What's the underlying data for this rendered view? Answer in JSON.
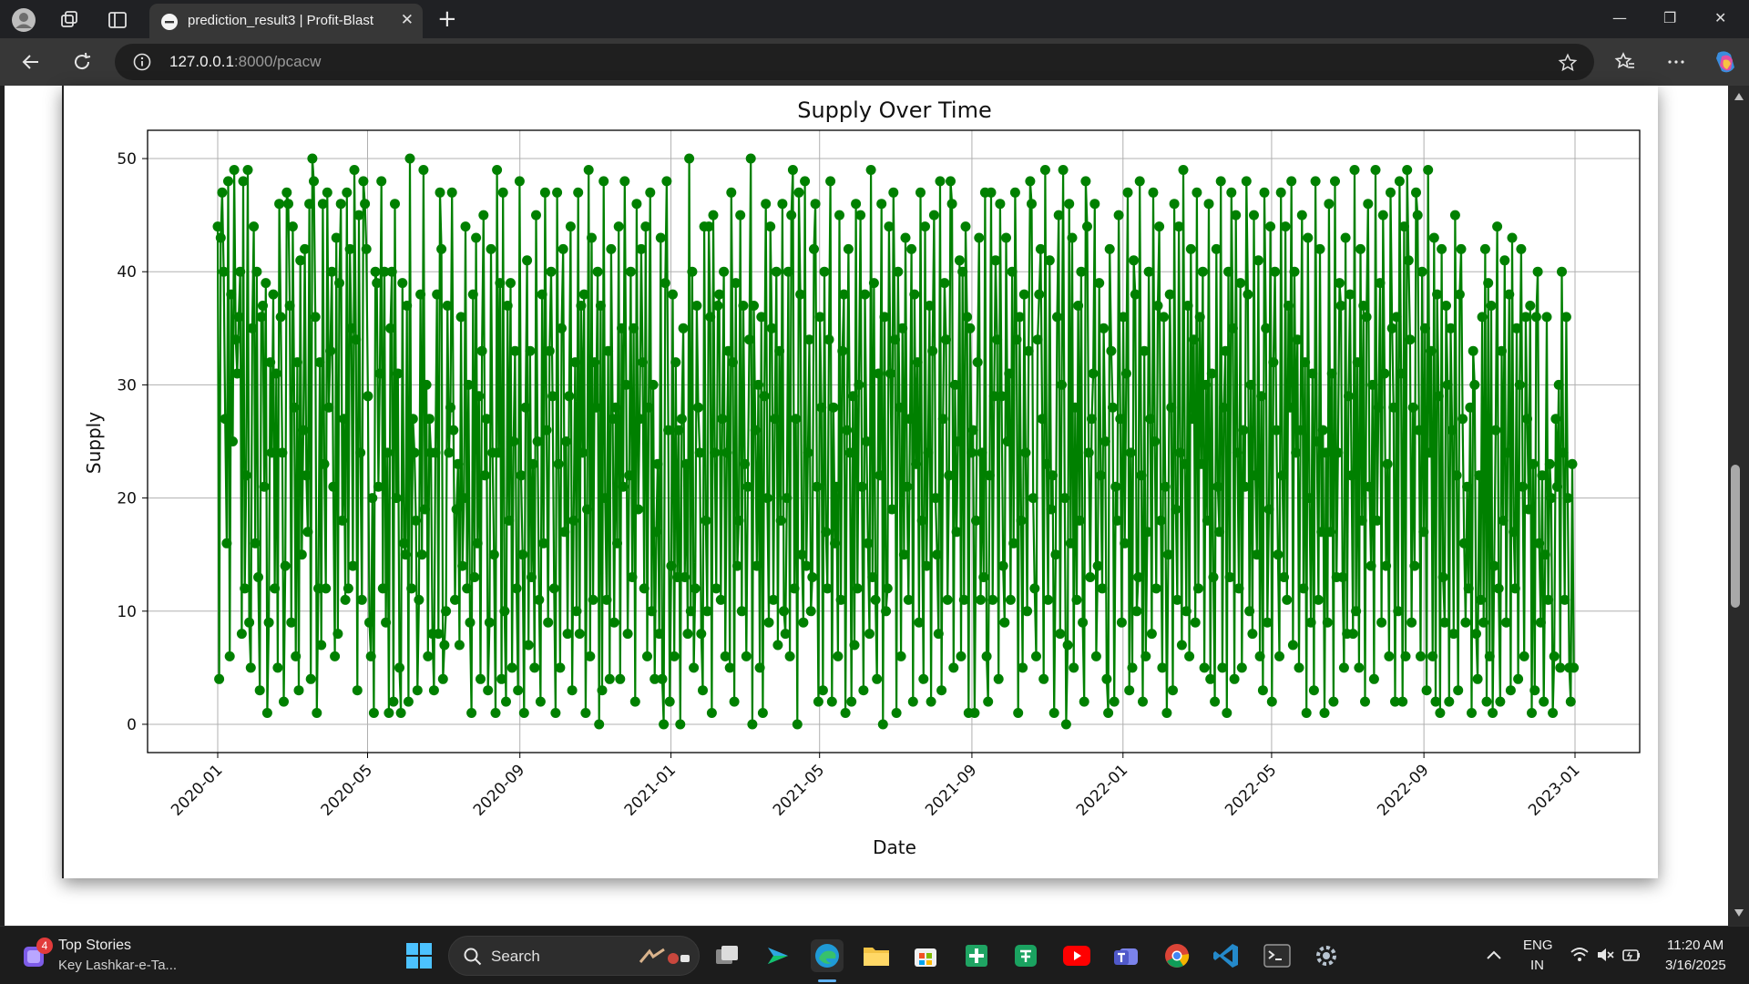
{
  "browser": {
    "tab_title": "prediction_result3 | Profit-Blast",
    "tab_close": "✕",
    "new_tab": "+",
    "url_host": "127.0.0.1",
    "url_rest": ":8000/pcacw",
    "window_controls": {
      "minimize": "—",
      "restore": "❐",
      "close": "✕"
    }
  },
  "chart_data": {
    "type": "line",
    "title": "Supply Over Time",
    "xlabel": "Date",
    "ylabel": "Supply",
    "ylim": [
      -2.5,
      52.5
    ],
    "yticks": [
      0,
      10,
      20,
      30,
      40,
      50
    ],
    "x_tick_labels": [
      "2020-01",
      "2020-05",
      "2020-09",
      "2021-01",
      "2021-05",
      "2021-09",
      "2022-01",
      "2022-05",
      "2022-09",
      "2023-01"
    ],
    "x_tick_dates": [
      "2020-01-01",
      "2020-05-01",
      "2020-09-01",
      "2021-01-01",
      "2021-05-01",
      "2021-09-01",
      "2022-01-01",
      "2022-05-01",
      "2022-09-01",
      "2023-01-01"
    ],
    "x_start": "2020-01-01",
    "x_end": "2022-12-31",
    "grid": true,
    "marker": "circle",
    "line_color": "#008000",
    "series": [
      {
        "values": [
          44,
          4,
          43,
          47,
          40,
          27,
          16,
          48,
          6,
          38,
          25,
          49,
          34,
          31,
          36,
          40,
          8,
          48,
          12,
          22,
          49,
          9,
          5,
          35,
          44,
          16,
          40,
          13,
          3,
          36,
          37,
          21,
          39,
          1,
          9,
          32,
          24,
          38,
          12,
          31,
          5,
          46,
          36,
          24,
          2,
          14,
          47,
          46,
          37,
          9,
          44,
          28,
          6,
          32,
          3,
          41,
          15,
          26,
          42,
          22,
          17,
          46,
          4,
          50,
          48,
          36,
          1,
          12,
          32,
          7,
          46,
          23,
          12,
          47,
          28,
          33,
          40,
          21,
          6,
          43,
          8,
          39,
          46,
          18,
          27,
          11,
          47,
          12,
          42,
          35,
          14,
          49,
          34,
          3,
          45,
          24,
          11,
          48,
          46,
          42,
          29,
          9,
          6,
          20,
          1,
          40,
          39,
          21,
          31,
          48,
          12,
          40,
          9,
          24,
          1,
          35,
          40,
          2,
          46,
          20,
          31,
          5,
          1,
          39,
          16,
          15,
          37,
          2,
          50,
          12,
          27,
          24,
          18,
          3,
          11,
          38,
          15,
          49,
          19,
          30,
          6,
          27,
          24,
          8,
          3,
          24,
          38,
          8,
          47,
          42,
          4,
          7,
          10,
          37,
          24,
          28,
          47,
          26,
          11,
          19,
          23,
          7,
          36,
          14,
          20,
          44,
          12,
          30,
          9,
          1,
          38,
          13,
          43,
          16,
          29,
          4,
          33,
          45,
          22,
          27,
          3,
          9,
          42,
          24,
          15,
          1,
          49,
          24,
          39,
          4,
          47,
          10,
          2,
          37,
          18,
          39,
          5,
          25,
          33,
          12,
          3,
          48,
          22,
          15,
          1,
          28,
          41,
          7,
          33,
          13,
          23,
          5,
          45,
          25,
          11,
          2,
          38,
          16,
          47,
          26,
          9,
          33,
          40,
          29,
          12,
          1,
          47,
          23,
          5,
          35,
          42,
          17,
          25,
          8,
          29,
          44,
          3,
          18,
          32,
          10,
          47,
          8,
          37,
          24,
          38,
          1,
          19,
          49,
          6,
          43,
          11,
          32,
          28,
          40,
          0,
          37,
          3,
          48,
          20,
          11,
          33,
          4,
          42,
          27,
          9,
          28,
          16,
          44,
          4,
          35,
          21,
          48,
          30,
          8,
          22,
          40,
          13,
          35,
          2,
          46,
          19,
          27,
          42,
          32,
          12,
          44,
          6,
          28,
          47,
          10,
          30,
          4,
          17,
          23,
          8,
          43,
          4,
          0,
          39,
          48,
          26,
          2,
          14,
          38,
          6,
          32,
          13,
          26,
          0,
          27,
          35,
          13,
          23,
          8,
          50,
          10,
          40,
          5,
          12,
          37,
          28,
          24,
          8,
          3,
          44,
          18,
          10,
          44,
          36,
          1,
          45,
          24,
          12,
          37,
          38,
          11,
          27,
          40,
          6,
          24,
          33,
          5,
          47,
          32,
          2,
          39,
          14,
          18,
          45,
          10,
          37,
          23,
          6,
          21,
          34,
          50,
          0,
          37,
          26,
          14,
          30,
          5,
          36,
          1,
          29,
          46,
          20,
          9,
          44,
          35,
          11,
          27,
          40,
          7,
          33,
          18,
          46,
          10,
          8,
          20,
          40,
          6,
          45,
          49,
          12,
          27,
          0,
          47,
          38,
          15,
          9,
          48,
          14,
          24,
          34,
          10,
          13,
          42,
          46,
          21,
          2,
          36,
          28,
          3,
          40,
          17,
          12,
          34,
          48,
          2,
          28,
          16,
          21,
          6,
          45,
          11,
          33,
          38,
          1,
          26,
          42,
          24,
          2,
          29,
          7,
          46,
          12,
          30,
          45,
          21,
          3,
          38,
          25,
          16,
          8,
          49,
          13,
          39,
          11,
          4,
          31,
          22,
          46,
          0,
          36,
          10,
          12,
          44,
          31,
          19,
          47,
          34,
          1,
          40,
          28,
          6,
          35,
          15,
          43,
          21,
          11,
          27,
          42,
          2,
          38,
          23,
          32,
          9,
          47,
          18,
          4,
          44,
          14,
          24,
          37,
          2,
          33,
          45,
          20,
          15,
          8,
          48,
          3,
          27,
          39,
          34,
          11,
          22,
          48,
          46,
          5,
          30,
          17,
          25,
          41,
          6,
          40,
          11,
          44,
          36,
          1,
          35,
          24,
          26,
          1,
          18,
          32,
          43,
          11,
          24,
          13,
          47,
          6,
          2,
          22,
          47,
          11,
          29,
          41,
          34,
          4,
          46,
          29,
          14,
          9,
          43,
          25,
          31,
          11,
          40,
          16,
          47,
          34,
          1,
          36,
          18,
          5,
          38,
          24,
          10,
          33,
          48,
          46,
          20,
          12,
          6,
          34,
          38,
          42,
          27,
          4,
          49,
          23,
          11,
          41,
          19,
          22,
          1,
          15,
          36,
          45,
          8,
          30,
          49,
          20,
          0,
          7,
          46,
          16,
          43,
          5,
          28,
          11,
          37,
          18,
          40,
          9,
          2,
          48,
          44,
          24,
          13,
          27,
          31,
          46,
          6,
          14,
          39,
          22,
          12,
          35,
          25,
          4,
          1,
          42,
          33,
          28,
          2,
          21,
          18,
          45,
          27,
          9,
          36,
          16,
          31,
          47,
          3,
          24,
          5,
          41,
          38,
          10,
          13,
          48,
          22,
          2,
          33,
          6,
          17,
          40,
          27,
          8,
          47,
          25,
          12,
          37,
          44,
          18,
          5,
          36,
          21,
          1,
          15,
          38,
          28,
          3,
          46,
          19,
          11,
          44,
          24,
          7,
          49,
          23,
          10,
          37,
          6,
          42,
          27,
          34,
          9,
          47,
          12,
          36,
          23,
          40,
          5,
          30,
          18,
          46,
          4,
          31,
          13,
          2,
          42,
          21,
          17,
          48,
          5,
          28,
          33,
          1,
          40,
          13,
          47,
          35,
          4,
          45,
          24,
          12,
          39,
          5,
          26,
          21,
          48,
          38,
          10,
          30,
          8,
          45,
          22,
          15,
          41,
          6,
          29,
          3,
          47,
          35,
          9,
          19,
          44,
          2,
          32,
          40,
          26,
          15,
          6,
          47,
          22,
          13,
          44,
          11,
          37,
          28,
          48,
          7,
          40,
          24,
          34,
          5,
          26,
          45,
          12,
          32,
          1,
          43,
          20,
          9,
          31,
          3,
          48,
          25,
          11,
          42,
          17,
          26,
          1,
          24,
          9,
          46,
          17,
          31,
          2,
          48,
          13,
          24,
          39,
          37,
          13,
          5,
          43,
          8,
          29,
          38,
          22,
          8,
          49,
          10,
          32,
          5,
          42,
          18,
          37,
          2,
          36,
          46,
          21,
          14,
          30,
          4,
          49,
          18,
          28,
          39,
          9,
          45,
          31,
          14,
          23,
          6,
          47,
          35,
          28,
          2,
          36,
          10,
          48,
          31,
          2,
          44,
          6,
          49,
          41,
          34,
          9,
          28,
          14,
          47,
          45,
          26,
          6,
          40,
          17,
          35,
          3,
          49,
          24,
          33,
          6,
          43,
          2,
          38,
          29,
          1,
          42,
          13,
          9,
          37,
          30,
          2,
          35,
          26,
          8,
          45,
          22,
          3,
          38,
          42,
          27,
          16,
          9,
          21,
          12,
          28,
          1,
          33,
          30,
          8,
          4,
          22,
          11,
          36,
          9,
          42,
          2,
          39,
          6,
          37,
          1,
          14,
          26,
          44,
          12,
          2,
          33,
          18,
          41,
          9,
          24,
          38,
          3,
          43,
          17,
          12,
          35,
          4,
          30,
          42,
          21,
          6,
          36,
          27,
          19,
          37,
          1,
          23,
          3,
          36,
          40,
          16,
          9,
          22,
          2,
          15,
          36,
          11,
          23,
          20,
          1,
          6,
          27,
          21,
          30,
          5,
          40,
          24,
          11,
          36,
          20,
          5,
          2,
          23,
          5
        ]
      }
    ]
  },
  "taskbar": {
    "news_badge": "4",
    "news_title": "Top Stories",
    "news_subtitle": "Key Lashkar-e-Ta...",
    "search_label": "Search",
    "lang_top": "ENG",
    "lang_bottom": "IN",
    "time": "11:20 AM",
    "date": "3/16/2025"
  },
  "colors": {
    "line": "#008000",
    "tab_bg": "#373737",
    "taskbar_bg": "#1c1c1c"
  }
}
